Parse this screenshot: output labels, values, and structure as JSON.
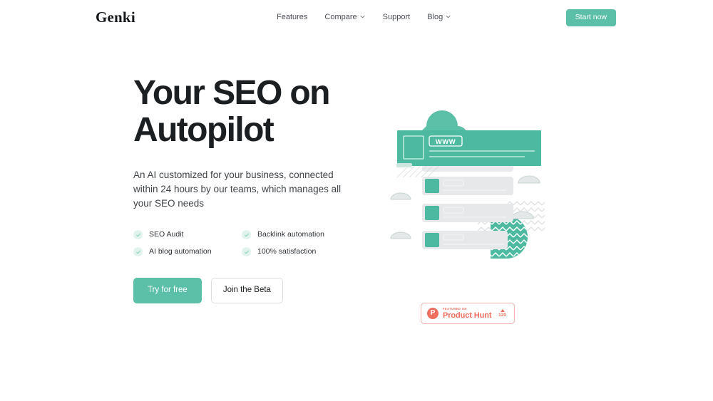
{
  "brand": {
    "logo": "Genki",
    "accent": "#5cbfa8",
    "accent_light": "#e2f3ee",
    "ink": "#1c1f21",
    "producthunt": "#ef6f5e"
  },
  "header": {
    "nav": [
      {
        "label": "Features",
        "has_chevron": false
      },
      {
        "label": "Compare",
        "has_chevron": true
      },
      {
        "label": "Support",
        "has_chevron": false
      },
      {
        "label": "Blog",
        "has_chevron": true
      }
    ],
    "cta": "Start now"
  },
  "hero": {
    "headline": "Your SEO on Autopilot",
    "subheadline": "An AI customized for your business, connected within 24 hours by our teams, which manages all your SEO needs",
    "features": [
      "SEO Audit",
      "Backlink automation",
      "AI blog automation",
      "100% satisfaction"
    ],
    "primary_cta": "Try for free",
    "secondary_cta": "Join the Beta"
  },
  "illustration": {
    "browser_label": "WWW"
  },
  "product_hunt": {
    "featured_on": "FEATURED ON",
    "name": "Product Hunt",
    "votes": "120"
  }
}
